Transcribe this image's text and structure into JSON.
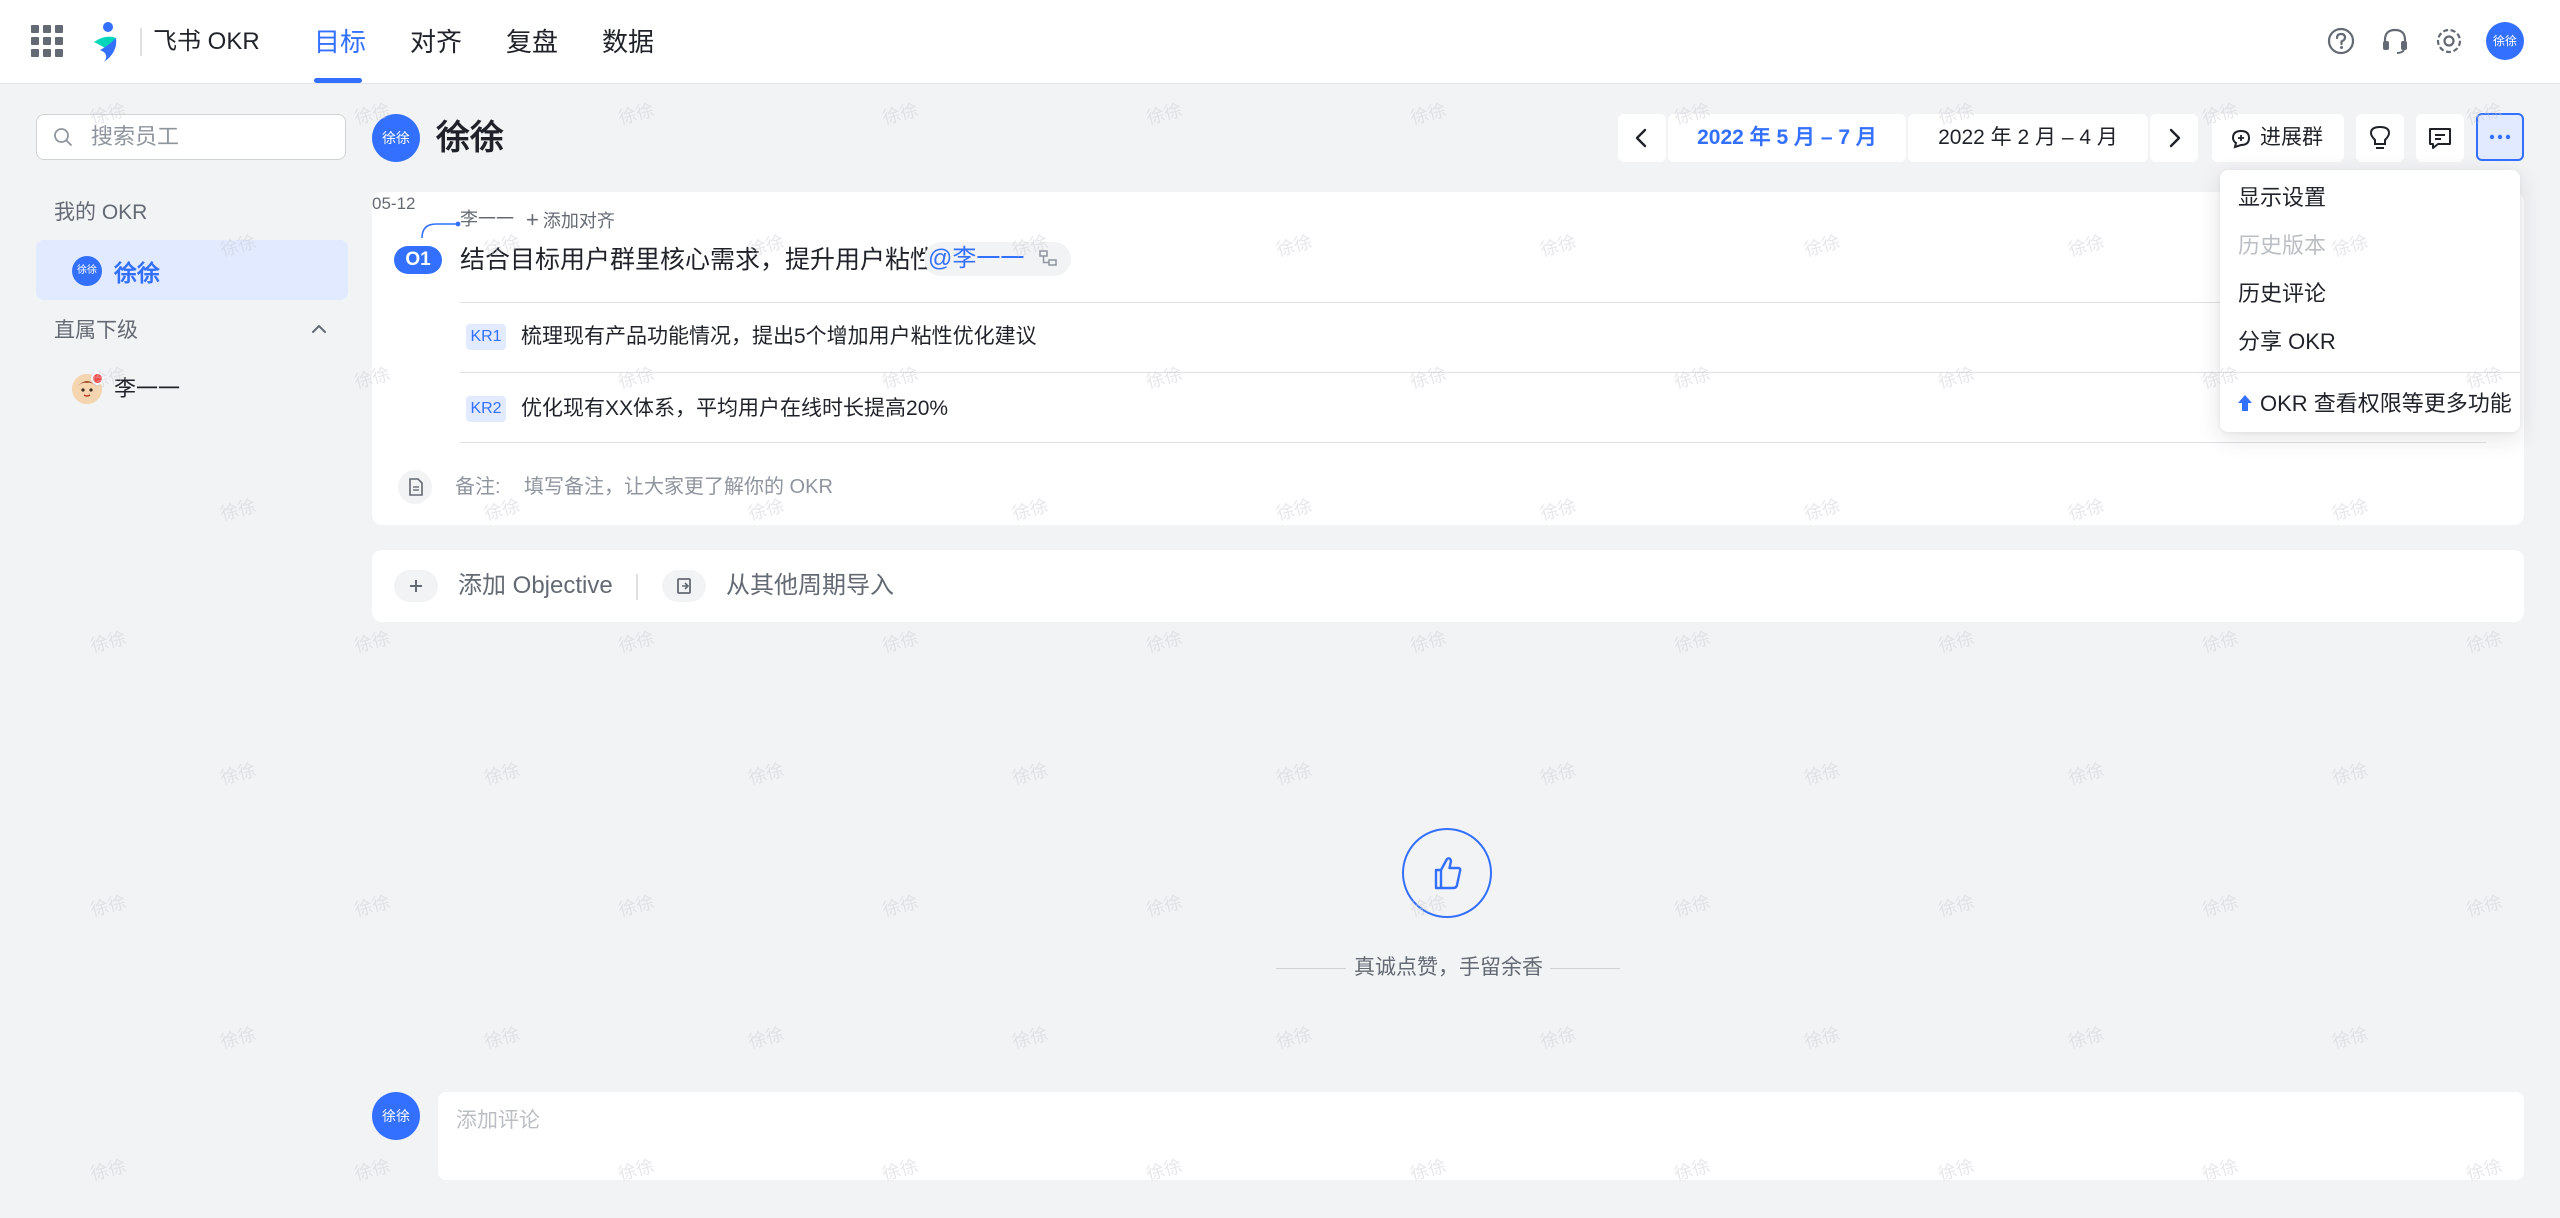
{
  "app": {
    "name": "飞书 OKR",
    "accent": "#3370ff"
  },
  "nav": {
    "tabs": [
      {
        "label": "目标",
        "active": true
      },
      {
        "label": "对齐",
        "active": false
      },
      {
        "label": "复盘",
        "active": false
      },
      {
        "label": "数据",
        "active": false
      }
    ]
  },
  "topbar": {
    "icons": [
      "help-icon",
      "headset-icon",
      "settings-icon"
    ],
    "avatar_text": "徐徐"
  },
  "sidebar": {
    "search_placeholder": "搜索员工",
    "my_okr_title": "我的 OKR",
    "my_okr_user": {
      "avatar_text": "徐徐",
      "name": "徐徐"
    },
    "subordinates_title": "直属下级",
    "subordinates": [
      {
        "name": "李一一"
      }
    ]
  },
  "header": {
    "avatar_text": "徐徐",
    "user_name": "徐徐",
    "current_period": "2022 年 5 月 – 7 月",
    "other_period": "2022 年 2 月 – 4 月",
    "progress_group_label": "进展群"
  },
  "objective": {
    "date_tag": "05-12",
    "aligned_to": "李一一",
    "add_align_label": "添加对齐",
    "badge": "O1",
    "title": "结合目标用户群里核心需求，提升用户粘性",
    "mention": "@李一一",
    "key_results": [
      {
        "badge": "KR1",
        "text": "梳理现有产品功能情况，提出5个增加用户粘性优化建议"
      },
      {
        "badge": "KR2",
        "text": "优化现有XX体系，平均用户在线时长提高20%"
      }
    ],
    "note_label": "备注:",
    "note_placeholder": "填写备注，让大家更了解你的 OKR"
  },
  "actions": {
    "add_objective": "添加 Objective",
    "import_from_period": "从其他周期导入"
  },
  "like": {
    "text": "真诚点赞，手留余香"
  },
  "comment": {
    "avatar_text": "徐徐",
    "placeholder": "添加评论"
  },
  "more_menu": {
    "items": [
      {
        "label": "显示设置",
        "disabled": false
      },
      {
        "label": "历史版本",
        "disabled": true
      },
      {
        "label": "历史评论",
        "disabled": false
      },
      {
        "label": "分享 OKR",
        "disabled": false
      }
    ],
    "upgrade_label": "OKR 查看权限等更多功能"
  },
  "watermark": "徐徐"
}
